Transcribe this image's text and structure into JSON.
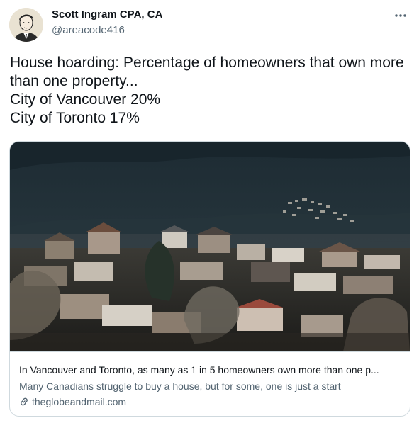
{
  "author": {
    "name": "Scott Ingram CPA, CA",
    "handle": "@areacode416",
    "avatar_icon": "cartoon-portrait-avatar"
  },
  "more_icon": "more-horizontal-icon",
  "tweet": {
    "text": "House hoarding: Percentage of homeowners that own more than one property...\nCity of Vancouver 20%\nCity of Toronto 17%"
  },
  "card": {
    "title": "In Vancouver and Toronto, as many as 1 in 5 homeowners own more than one p...",
    "description": "Many Canadians struggle to buy a house, but for some, one is just a start",
    "domain": "theglobeandmail.com",
    "domain_icon": "link-icon",
    "image_subject": "hillside houses photo"
  },
  "colors": {
    "text": "#0f1419",
    "secondary": "#536471",
    "border": "#cfd9de"
  }
}
